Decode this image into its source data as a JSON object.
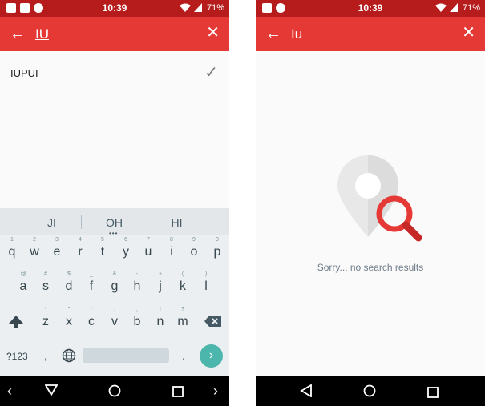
{
  "left": {
    "status": {
      "time": "10:39",
      "battery": "71%"
    },
    "appbar": {
      "query": "IU"
    },
    "results": [
      {
        "label": "IUPUI"
      }
    ],
    "keyboard": {
      "suggestions": [
        "JI",
        "OH",
        "HI"
      ],
      "row1": [
        {
          "k": "q",
          "h": "1"
        },
        {
          "k": "w",
          "h": "2"
        },
        {
          "k": "e",
          "h": "3"
        },
        {
          "k": "r",
          "h": "4"
        },
        {
          "k": "t",
          "h": "5"
        },
        {
          "k": "y",
          "h": "6"
        },
        {
          "k": "u",
          "h": "7"
        },
        {
          "k": "i",
          "h": "8"
        },
        {
          "k": "o",
          "h": "9"
        },
        {
          "k": "p",
          "h": "0"
        }
      ],
      "row2": [
        {
          "k": "a",
          "h": "@"
        },
        {
          "k": "s",
          "h": "#"
        },
        {
          "k": "d",
          "h": "$"
        },
        {
          "k": "f",
          "h": "_"
        },
        {
          "k": "g",
          "h": "&"
        },
        {
          "k": "h",
          "h": "-"
        },
        {
          "k": "j",
          "h": "+"
        },
        {
          "k": "k",
          "h": "("
        },
        {
          "k": "l",
          "h": ")"
        }
      ],
      "row3": [
        {
          "k": "z",
          "h": "*"
        },
        {
          "k": "x",
          "h": "\""
        },
        {
          "k": "c",
          "h": "'"
        },
        {
          "k": "v",
          "h": ":"
        },
        {
          "k": "b",
          "h": ";"
        },
        {
          "k": "n",
          "h": "!"
        },
        {
          "k": "m",
          "h": "?"
        }
      ],
      "k123": "?123",
      "comma": ",",
      "period": "."
    }
  },
  "right": {
    "status": {
      "time": "10:39",
      "battery": "71%"
    },
    "appbar": {
      "query": "Iu"
    },
    "empty_message": "Sorry... no search results"
  },
  "icons": {
    "back": "arrow-back-icon",
    "close": "close-icon",
    "check": "check-icon",
    "search": "magnifier-icon",
    "pin": "map-pin-icon"
  },
  "colors": {
    "status_bar": "#b71c1c",
    "app_bar": "#e53935",
    "accent_enter": "#4db6ac",
    "magnifier": "#e53935"
  }
}
